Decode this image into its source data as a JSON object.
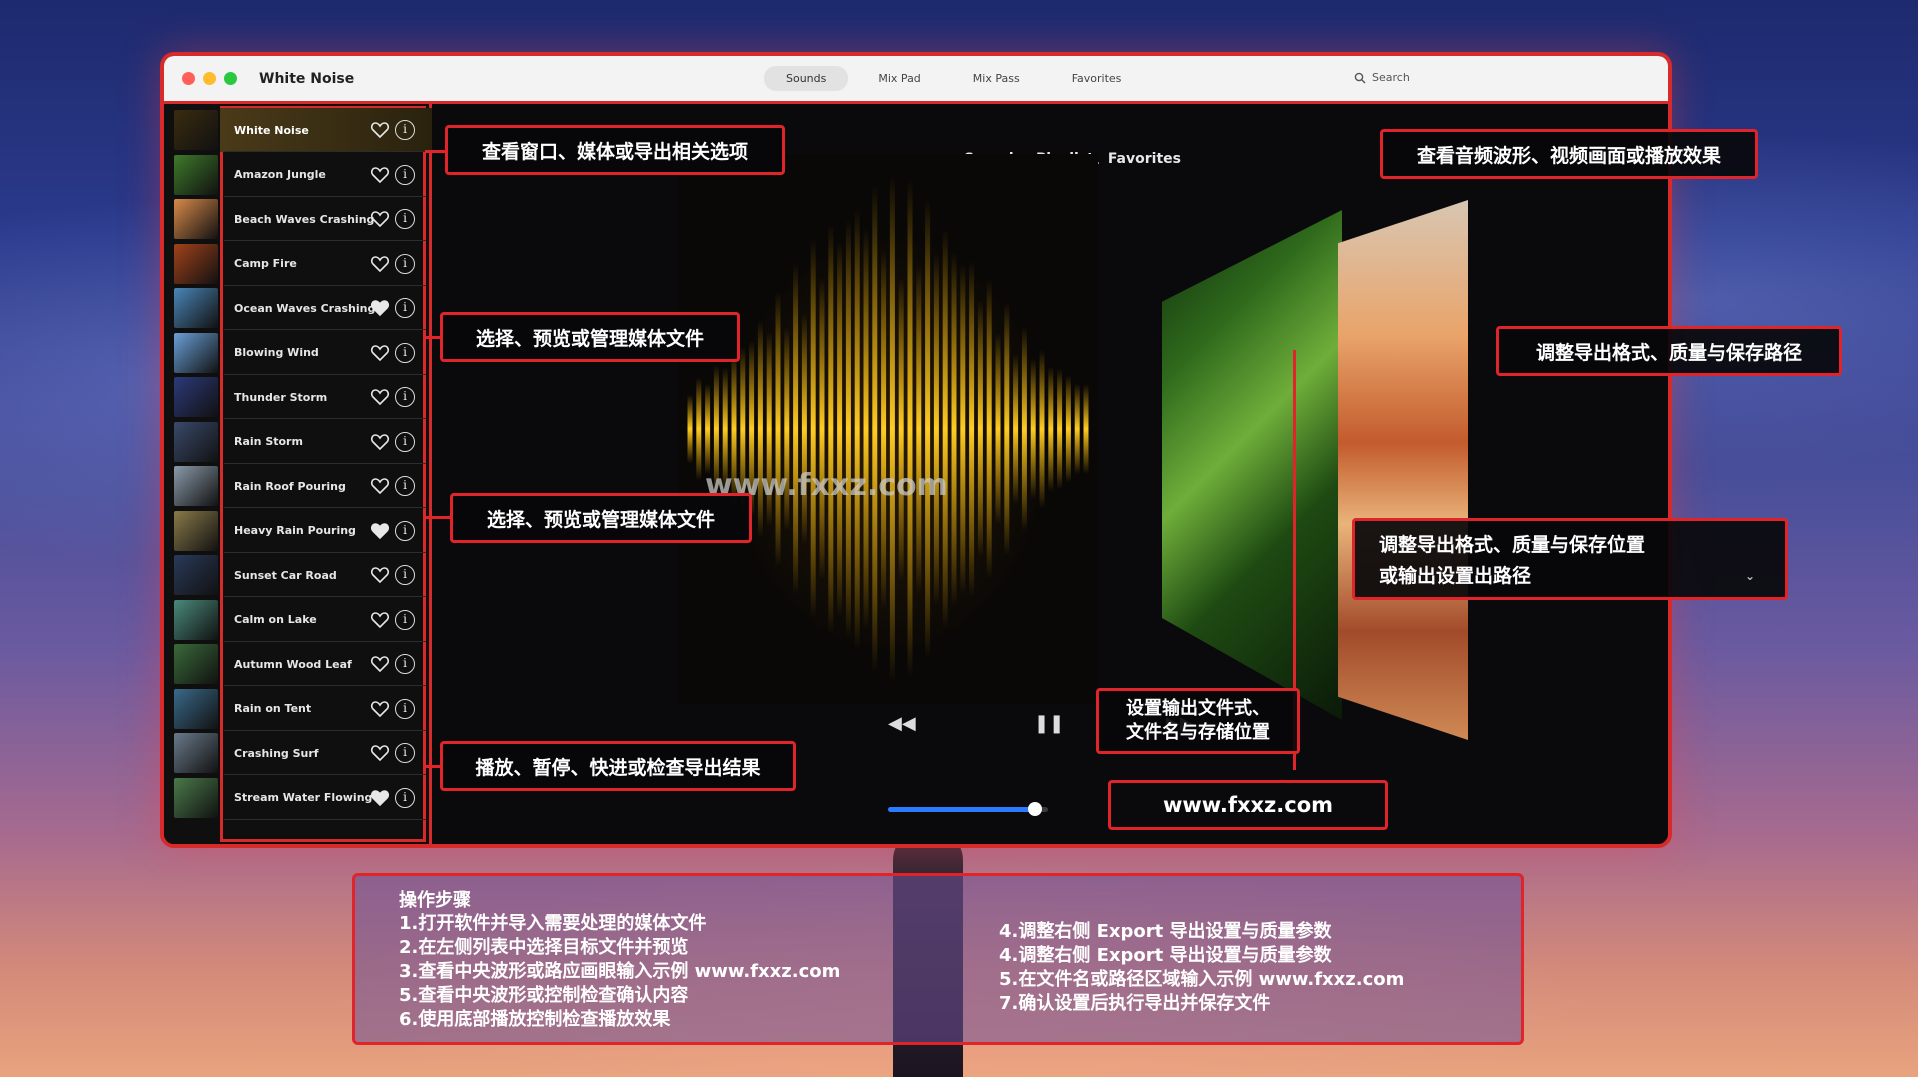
{
  "window": {
    "title": "White Noise",
    "tabs": [
      {
        "label": "Sounds",
        "active": true
      },
      {
        "label": "Mix Pad",
        "active": false
      },
      {
        "label": "Mix Pass",
        "active": false
      },
      {
        "label": "Favorites",
        "active": false
      }
    ],
    "search_label": "Search"
  },
  "sidebar": {
    "items": [
      {
        "label": "White Noise",
        "favorite": false,
        "active": true,
        "thumb": "#3a2c10"
      },
      {
        "label": "Amazon Jungle",
        "favorite": false,
        "thumb": "#3e7a2a"
      },
      {
        "label": "Beach Waves Crashing",
        "favorite": false,
        "thumb": "#d88a4a"
      },
      {
        "label": "Camp Fire",
        "favorite": false,
        "thumb": "#a2421a"
      },
      {
        "label": "Ocean Waves Crashing",
        "favorite": true,
        "thumb": "#4a86b8"
      },
      {
        "label": "Blowing Wind",
        "favorite": false,
        "thumb": "#6aa0d8"
      },
      {
        "label": "Thunder Storm",
        "favorite": false,
        "thumb": "#2c3a7a"
      },
      {
        "label": "Rain Storm",
        "favorite": false,
        "thumb": "#3a4a6a"
      },
      {
        "label": "Rain Roof Pouring",
        "favorite": false,
        "thumb": "#8a9aaa"
      },
      {
        "label": "Heavy Rain Pouring",
        "favorite": true,
        "thumb": "#8a7a4a"
      },
      {
        "label": "Sunset Car Road",
        "favorite": false,
        "thumb": "#2a3a5a"
      },
      {
        "label": "Calm on Lake",
        "favorite": false,
        "thumb": "#4a8a7a"
      },
      {
        "label": "Autumn Wood Leaf",
        "favorite": false,
        "thumb": "#3a6a3a"
      },
      {
        "label": "Rain on Tent",
        "favorite": false,
        "thumb": "#3a6a8a"
      },
      {
        "label": "Crashing Surf",
        "favorite": false,
        "thumb": "#6a7a8a"
      },
      {
        "label": "Stream Water Flowing",
        "favorite": true,
        "thumb": "#4a7a4a"
      }
    ]
  },
  "main": {
    "heading": "Sounds、Playlist、Favorites",
    "watermark": "www.fxxz.com",
    "progress": 0.92,
    "controls": {
      "rewind": "◀◀",
      "pause": "❚❚",
      "forward": "▶▶"
    }
  },
  "callouts": {
    "c1": "查看窗口、媒体或导出相关选项",
    "c2": "选择、预览或管理媒体文件",
    "c3": "选择、预览或管理媒体文件",
    "c4": "播放、暂停、快进或检查导出结果",
    "c5": "查看音频波形、视频画面或播放效果",
    "c6": "调整导出格式、质量与保存路径",
    "c7_line1": "调整导出格式、质量与保存位置",
    "c7_line2": "或输出设置出路径",
    "c8_line1": "设置输出文件式、",
    "c8_line2": "文件名与存储位置",
    "url": "www.fxxz.com"
  },
  "steps": {
    "title": "操作步骤",
    "left": [
      "1.打开软件并导入需要处理的媒体文件",
      "2.在左侧列表中选择目标文件并预览",
      "3.查看中央波形或路应画眼输入示例 www.fxxz.com",
      "5.查看中央波形或控制检查确认内容",
      "6.使用底部播放控制检查播放效果"
    ],
    "right": [
      "4.调整右侧 Export 导出设置与质量参数",
      "4.调整右侧 Export 导出设置与质量参数",
      "5.在文件名或路径区域输入示例 www.fxxz.com",
      "7.确认设置后执行导出并保存文件"
    ]
  },
  "colors": {
    "accent_red": "#e0242a",
    "wave_gold": "#f5b400",
    "progress_blue": "#2a7bff"
  }
}
